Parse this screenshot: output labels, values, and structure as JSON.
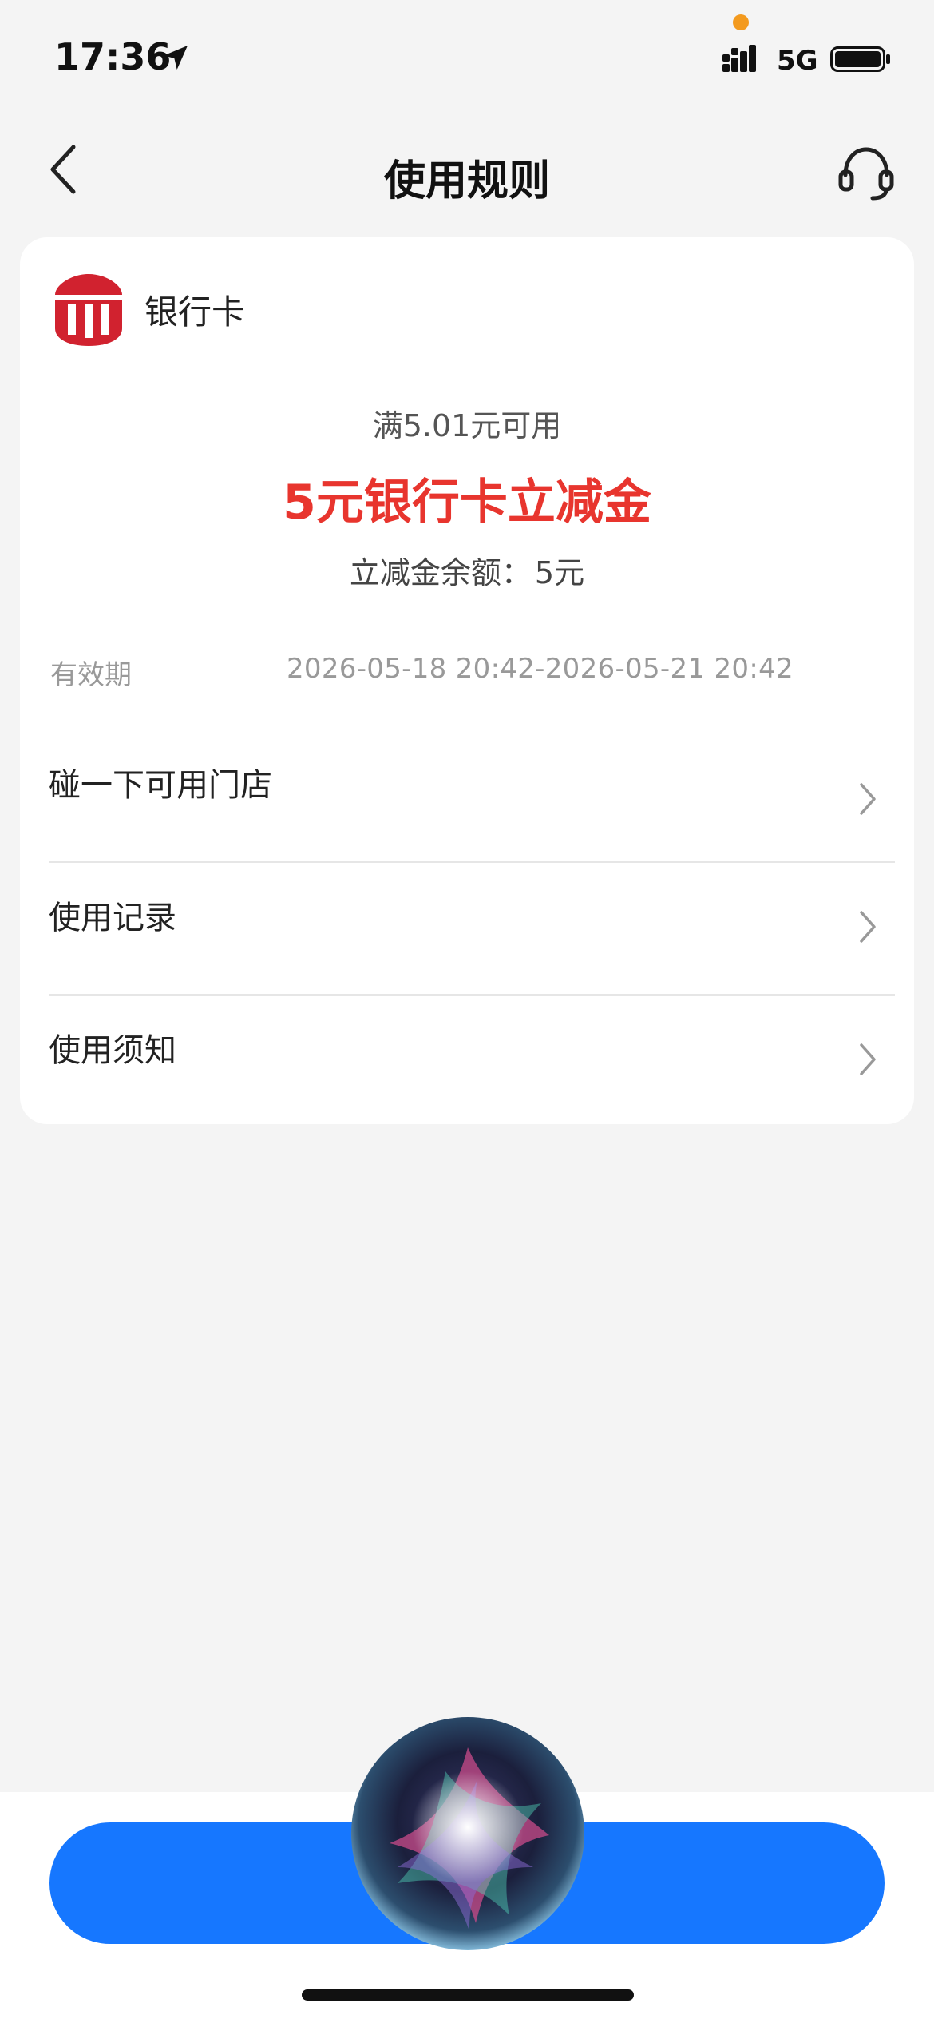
{
  "status_bar": {
    "time": "17:36",
    "network": "5G",
    "location_icon": "location-arrow-icon",
    "signal_icon": "signal-bars-icon",
    "battery_icon": "battery-icon"
  },
  "nav": {
    "title": "使用规则",
    "back_icon": "chevron-left-icon",
    "service_icon": "headset-icon"
  },
  "card": {
    "bank_logo_icon": "bank-logo-icon",
    "header_label": "银行卡",
    "condition": "满5.01元可用",
    "coupon_title": "5元银行卡立减金",
    "balance_label": "立减金余额：",
    "balance_value": "5元",
    "validity_label": "有效期",
    "validity_value": "2026-05-18 20:42-2026-05-21 20:42",
    "menu": [
      {
        "label": "碰一下可用门店"
      },
      {
        "label": "使用记录"
      },
      {
        "label": "使用须知"
      }
    ]
  },
  "colors": {
    "accent_red": "#e8352e",
    "primary_blue": "#1677ff",
    "page_bg": "#f4f4f4"
  },
  "overlay": {
    "siri_icon": "siri-orb-icon"
  }
}
